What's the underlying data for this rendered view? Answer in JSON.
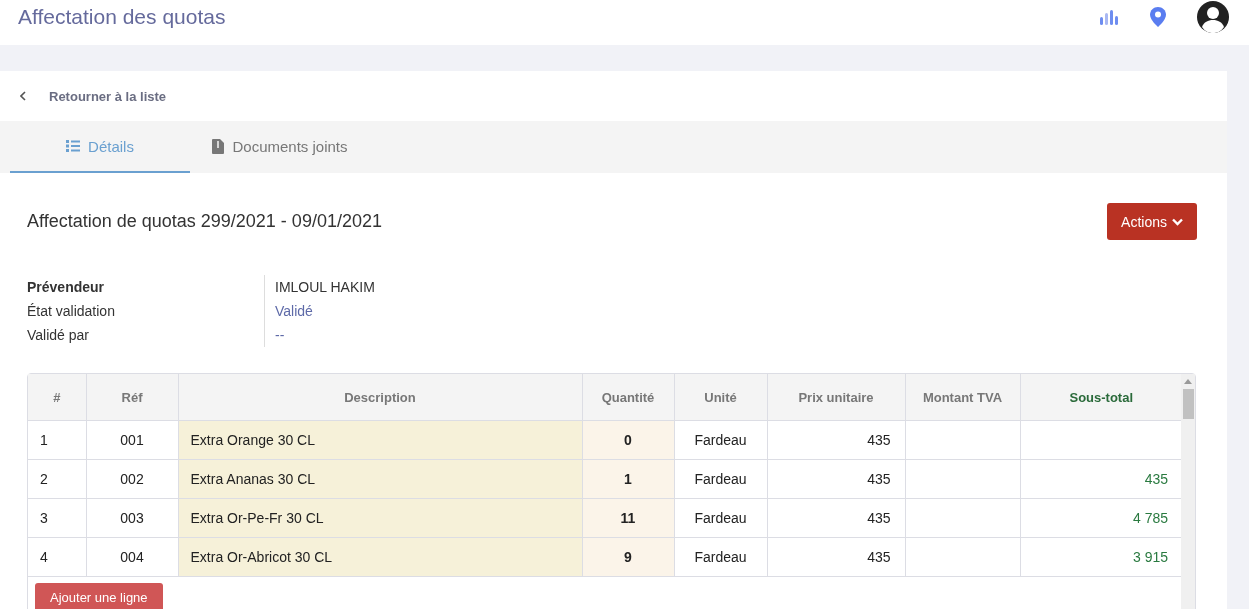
{
  "header": {
    "title": "Affectation des quotas"
  },
  "back_link": {
    "label": "Retourner à la liste"
  },
  "tabs": [
    {
      "label": "Détails",
      "kind": "list",
      "selected": true
    },
    {
      "label": "Documents joints",
      "kind": "file",
      "selected": false
    }
  ],
  "document": {
    "title": "Affectation de quotas 299/2021 - 09/01/2021",
    "actions_button": "Actions"
  },
  "fields": [
    {
      "label": "Prévendeur",
      "value": "IMLOUL HAKIM",
      "kind": "strong"
    },
    {
      "label": "État validation",
      "value": "Validé",
      "kind": "link"
    },
    {
      "label": "Validé par",
      "value": "--",
      "kind": "link"
    }
  ],
  "table": {
    "columns": [
      {
        "label": "#",
        "kind": "index"
      },
      {
        "label": "Réf",
        "kind": "center"
      },
      {
        "label": "Description",
        "kind": "desc"
      },
      {
        "label": "Quantité",
        "kind": "qty"
      },
      {
        "label": "Unité",
        "kind": "center"
      },
      {
        "label": "Prix unitaire",
        "kind": "num"
      },
      {
        "label": "Montant TVA",
        "kind": "num"
      },
      {
        "label": "Sous-total",
        "kind": "total"
      }
    ],
    "rows": [
      [
        "1",
        "001",
        "Extra Orange 30 CL",
        "0",
        "Fardeau",
        "435",
        "",
        ""
      ],
      [
        "2",
        "002",
        "Extra Ananas 30 CL",
        "1",
        "Fardeau",
        "435",
        "",
        "435"
      ],
      [
        "3",
        "003",
        "Extra Or-Pe-Fr 30 CL",
        "11",
        "Fardeau",
        "435",
        "",
        "4 785"
      ],
      [
        "4",
        "004",
        "Extra Or-Abricot 30 CL",
        "9",
        "Fardeau",
        "435",
        "",
        "3 915"
      ]
    ]
  },
  "add_line_button": "Ajouter une ligne"
}
